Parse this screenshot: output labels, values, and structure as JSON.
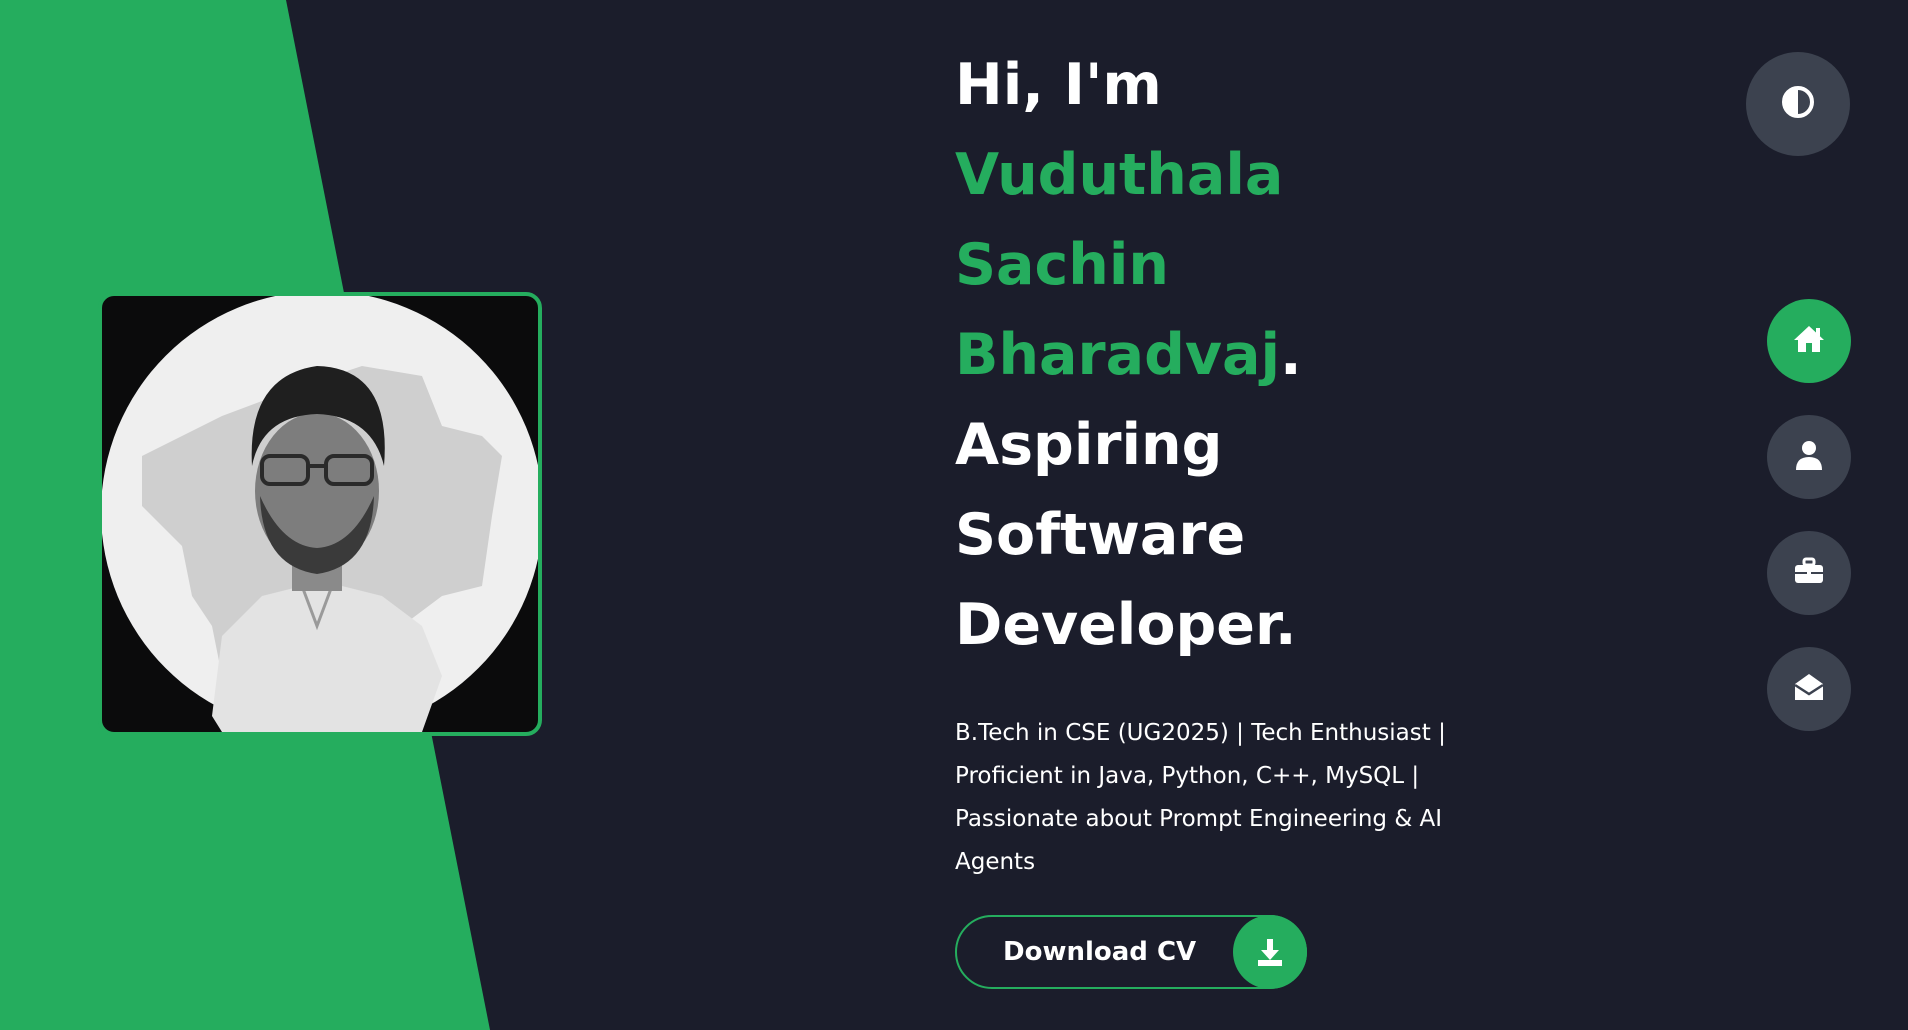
{
  "colors": {
    "accent": "#25ad5e",
    "background": "#1b1d2b",
    "nav_button": "#3c424f",
    "text": "#ffffff"
  },
  "hero": {
    "greeting": "Hi, I'm",
    "name_line_1": "Vuduthala",
    "name_line_2": "Sachin",
    "name_line_3": "Bharadvaj",
    "name_period": ".",
    "role_line_1": "Aspiring",
    "role_line_2": "Software",
    "role_line_3": "Developer.",
    "bio": "B.Tech in CSE (UG2025) | Tech Enthusiast | Proficient in Java, Python, C++, MySQL | Passionate about Prompt Engineering & AI Agents"
  },
  "cv_button": {
    "label": "Download CV",
    "icon": "download-icon"
  },
  "theme_toggle": {
    "icon": "contrast-icon"
  },
  "nav": [
    {
      "icon": "home-icon",
      "active": true
    },
    {
      "icon": "user-icon",
      "active": false
    },
    {
      "icon": "briefcase-icon",
      "active": false
    },
    {
      "icon": "envelope-open-icon",
      "active": false
    }
  ]
}
